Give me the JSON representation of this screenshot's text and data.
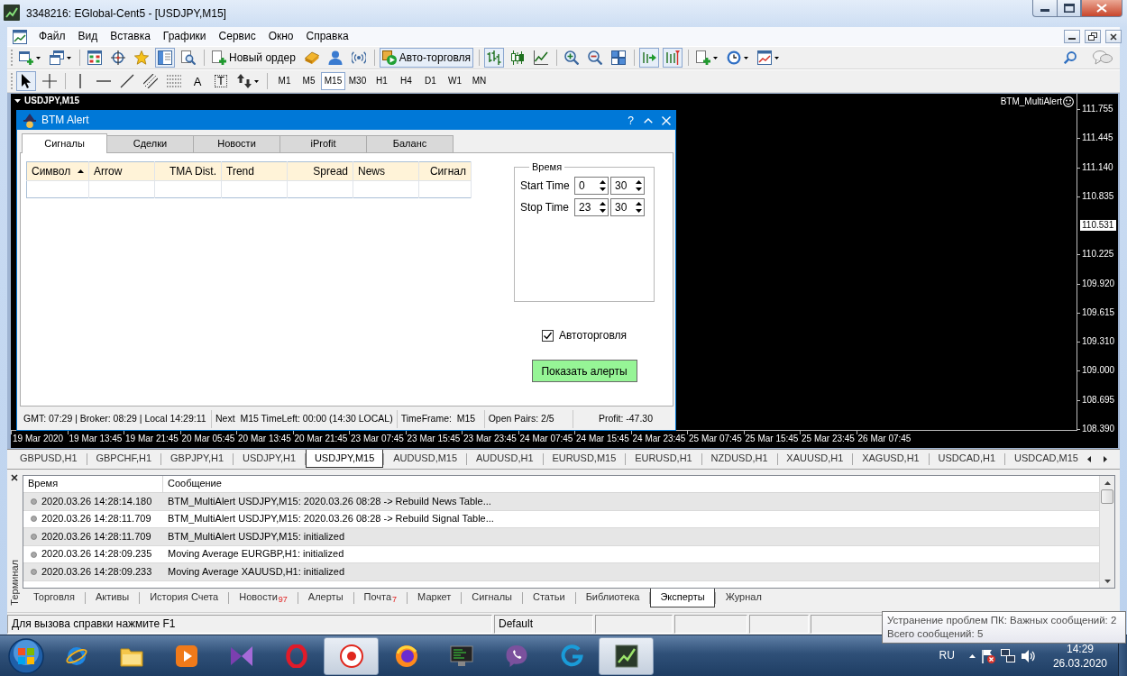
{
  "window": {
    "title": "3348216: EGlobal-Cent5 - [USDJPY,M15]"
  },
  "menu": [
    "Файл",
    "Вид",
    "Вставка",
    "Графики",
    "Сервис",
    "Окно",
    "Справка"
  ],
  "main_toolbar": [
    {
      "pressed": false
    },
    {
      "pressed": false
    },
    {
      "pressed": false
    },
    {
      "pressed": false
    },
    {
      "pressed": false
    },
    {
      "pressed": true
    },
    {
      "pressed": false
    },
    {
      "label": "Новый ордер",
      "pressed": false
    },
    {
      "pressed": false
    },
    {
      "pressed": false
    },
    {
      "pressed": false
    },
    {
      "label": "Авто-торговля",
      "pressed": true
    },
    {
      "pressed": true
    },
    {
      "pressed": false
    },
    {
      "pressed": false
    },
    {
      "pressed": false
    },
    {
      "pressed": false
    },
    {
      "pressed": false
    },
    {
      "pressed": true
    },
    {
      "pressed": true
    },
    {
      "pressed": false
    },
    {
      "pressed": false
    },
    {
      "pressed": false
    }
  ],
  "drawing_toolbar": [
    {
      "pressed": true
    },
    {
      "pressed": false
    },
    {
      "pressed": false
    },
    {
      "pressed": false
    },
    {
      "pressed": false
    },
    {
      "pressed": false
    },
    {
      "pressed": false
    },
    {
      "label": "A",
      "pressed": false
    },
    {
      "label": "T",
      "pressed": false
    },
    {
      "pressed": false
    }
  ],
  "timeframes": [
    {
      "label": "M1",
      "selected": false
    },
    {
      "label": "M5",
      "selected": false
    },
    {
      "label": "M15",
      "selected": true
    },
    {
      "label": "M30",
      "selected": false
    },
    {
      "label": "H1",
      "selected": false
    },
    {
      "label": "H4",
      "selected": false
    },
    {
      "label": "D1",
      "selected": false
    },
    {
      "label": "W1",
      "selected": false
    },
    {
      "label": "MN",
      "selected": false
    }
  ],
  "chart": {
    "title": "USDJPY,M15",
    "indicator": "BTM_MultiAlert",
    "price_scale": [
      {
        "label": "111.755",
        "current": false
      },
      {
        "label": "111.445",
        "current": false
      },
      {
        "label": "111.140",
        "current": false
      },
      {
        "label": "110.835",
        "current": false
      },
      {
        "label": "110.531",
        "current": true
      },
      {
        "label": "110.225",
        "current": false
      },
      {
        "label": "109.920",
        "current": false
      },
      {
        "label": "109.615",
        "current": false
      },
      {
        "label": "109.310",
        "current": false
      },
      {
        "label": "109.000",
        "current": false
      },
      {
        "label": "108.695",
        "current": false
      },
      {
        "label": "108.390",
        "current": false
      }
    ],
    "time_scale": [
      "19 Mar 2020",
      "19 Mar 13:45",
      "19 Mar 21:45",
      "20 Mar 05:45",
      "20 Mar 13:45",
      "20 Mar 21:45",
      "23 Mar 07:45",
      "23 Mar 15:45",
      "23 Mar 23:45",
      "24 Mar 07:45",
      "24 Mar 15:45",
      "24 Mar 23:45",
      "25 Mar 07:45",
      "25 Mar 15:45",
      "25 Mar 23:45",
      "26 Mar 07:45"
    ]
  },
  "dialog": {
    "title": "BTM Alert",
    "help": "?",
    "tabs": [
      {
        "label": "Сигналы",
        "selected": true
      },
      {
        "label": "Сделки",
        "selected": false
      },
      {
        "label": "Новости",
        "selected": false
      },
      {
        "label": "iProfit",
        "selected": false
      },
      {
        "label": "Баланс",
        "selected": false
      }
    ],
    "table": {
      "columns": [
        {
          "label": "Символ",
          "sorted": true
        },
        {
          "label": "Arrow",
          "sorted": false
        },
        {
          "label": "TMA Dist.",
          "sorted": false
        },
        {
          "label": "Trend",
          "sorted": false
        },
        {
          "label": "Spread",
          "sorted": false
        },
        {
          "label": "News",
          "sorted": false
        },
        {
          "label": "Сигнал",
          "sorted": false
        }
      ]
    },
    "time_group": {
      "title": "Время",
      "rows": [
        {
          "label": "Start Time",
          "hours": "0",
          "minutes": "30"
        },
        {
          "label": "Stop Time",
          "hours": "23",
          "minutes": "30"
        }
      ]
    },
    "autotrade": {
      "label": "Автоторговля",
      "checked": true
    },
    "alert_button": "Показать алерты",
    "status": [
      "GMT: 07:29 | Broker: 08:29 | Local 14:29:11",
      "Next  M15 TimeLeft: 00:00 (14:30 LOCAL)",
      "TimeFrame:  M15",
      "Open Pairs: 2/5",
      "Profit: -47.30"
    ]
  },
  "chart_tabs": [
    {
      "label": "GBPUSD,H1",
      "selected": false
    },
    {
      "label": "GBPCHF,H1",
      "selected": false
    },
    {
      "label": "GBPJPY,H1",
      "selected": false
    },
    {
      "label": "USDJPY,H1",
      "selected": false
    },
    {
      "label": "USDJPY,M15",
      "selected": true
    },
    {
      "label": "AUDUSD,M15",
      "selected": false
    },
    {
      "label": "AUDUSD,H1",
      "selected": false
    },
    {
      "label": "EURUSD,M15",
      "selected": false
    },
    {
      "label": "EURUSD,H1",
      "selected": false
    },
    {
      "label": "NZDUSD,H1",
      "selected": false
    },
    {
      "label": "XAUUSD,H1",
      "selected": false
    },
    {
      "label": "XAGUSD,H1",
      "selected": false
    },
    {
      "label": "USDCAD,H1",
      "selected": false
    },
    {
      "label": "USDCAD,M15",
      "selected": false
    }
  ],
  "terminal": {
    "label": "Терминал",
    "columns": [
      "Время",
      "Сообщение"
    ],
    "rows": [
      {
        "time": "2020.03.26 14:28:14.180",
        "message": "BTM_MultiAlert USDJPY,M15: 2020.03.26 08:28 -> Rebuild News Table..."
      },
      {
        "time": "2020.03.26 14:28:11.709",
        "message": "BTM_MultiAlert USDJPY,M15: 2020.03.26 08:28 -> Rebuild Signal Table..."
      },
      {
        "time": "2020.03.26 14:28:11.709",
        "message": "BTM_MultiAlert USDJPY,M15: initialized"
      },
      {
        "time": "2020.03.26 14:28:09.235",
        "message": "Moving Average EURGBP,H1: initialized"
      },
      {
        "time": "2020.03.26 14:28:09.233",
        "message": "Moving Average XAUUSD,H1: initialized"
      }
    ],
    "tabs": [
      {
        "label": "Торговля",
        "selected": false
      },
      {
        "label": "Активы",
        "selected": false
      },
      {
        "label": "История Счета",
        "selected": false
      },
      {
        "label": "Новости",
        "count": "97",
        "selected": false
      },
      {
        "label": "Алерты",
        "selected": false
      },
      {
        "label": "Почта",
        "count": "7",
        "selected": false
      },
      {
        "label": "Маркет",
        "selected": false
      },
      {
        "label": "Сигналы",
        "selected": false
      },
      {
        "label": "Статьи",
        "selected": false
      },
      {
        "label": "Библиотека",
        "selected": false
      },
      {
        "label": "Эксперты",
        "selected": true
      },
      {
        "label": "Журнал",
        "selected": false
      }
    ]
  },
  "status_bar": [
    "Для вызова справки нажмите F1",
    "Default"
  ],
  "tooltip": [
    "Устранение проблем ПК: Важных сообщений: 2",
    "Всего сообщений: 5"
  ],
  "taskbar": {
    "apps": [
      {
        "active": false
      },
      {
        "active": false
      },
      {
        "active": false
      },
      {
        "active": false
      },
      {
        "active": false
      },
      {
        "active": true
      },
      {
        "active": false
      },
      {
        "active": false
      },
      {
        "active": false
      },
      {
        "active": false
      },
      {
        "active": true
      }
    ],
    "language": "RU",
    "time": "14:29",
    "date": "26.03.2020"
  }
}
